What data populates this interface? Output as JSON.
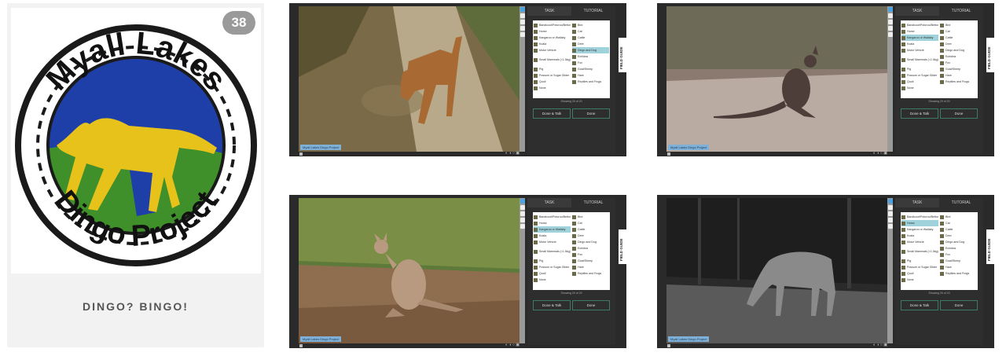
{
  "project": {
    "badge": "38",
    "logo_top": "Myall Lakes",
    "logo_bottom": "Dingo Project",
    "tagline": "DINGO? BINGO!"
  },
  "ui": {
    "tab_task": "TASK",
    "tab_tutorial": "TUTORIAL",
    "showing": "Showing 20 of 20",
    "done_talk": "Done & Talk",
    "done": "Done",
    "field_guide": "FIELD GUIDE",
    "caption": "Myall Lakes Dingo Project"
  },
  "choices": [
    {
      "label": "Bandicoot/Potoroo/Bettong",
      "tall": false
    },
    {
      "label": "Bird",
      "tall": false
    },
    {
      "label": "Horse",
      "tall": false
    },
    {
      "label": "Cat",
      "tall": false
    },
    {
      "label": "Kangaroo or Wallaby",
      "tall": false
    },
    {
      "label": "Cattle",
      "tall": false
    },
    {
      "label": "Koala",
      "tall": false
    },
    {
      "label": "Deer",
      "tall": false
    },
    {
      "label": "Motor Vehicle",
      "tall": false
    },
    {
      "label": "Dingo and Dog",
      "tall": false
    },
    {
      "label": "Small Mammals (<1.5kg)",
      "tall": true
    },
    {
      "label": "Echidna",
      "tall": false
    },
    {
      "label": "Fox",
      "tall": false
    },
    {
      "label": "Pig",
      "tall": false
    },
    {
      "label": "Goat/Sheep",
      "tall": false
    },
    {
      "label": "Possum or Sugar Glider",
      "tall": false
    },
    {
      "label": "Hare",
      "tall": false
    },
    {
      "label": "Quoll",
      "tall": false
    },
    {
      "label": "Reptiles and Frogs",
      "tall": false
    },
    {
      "label": "None",
      "tall": false
    }
  ],
  "panels": [
    {
      "id": "dingo",
      "highlight": "Dingo and Dog"
    },
    {
      "id": "wallaby-dark",
      "highlight": "Kangaroo or Wallaby"
    },
    {
      "id": "wallaby",
      "highlight": "Kangaroo or Wallaby"
    },
    {
      "id": "horse",
      "highlight": "Horse"
    }
  ],
  "colors": {
    "ring": "#1a1a1a",
    "sky": "#1f3fa8",
    "dingo": "#e6c21a",
    "bush": "#3f8f2a",
    "panel_bg": "#2a2a2a",
    "highlight": "#9fd2db"
  }
}
